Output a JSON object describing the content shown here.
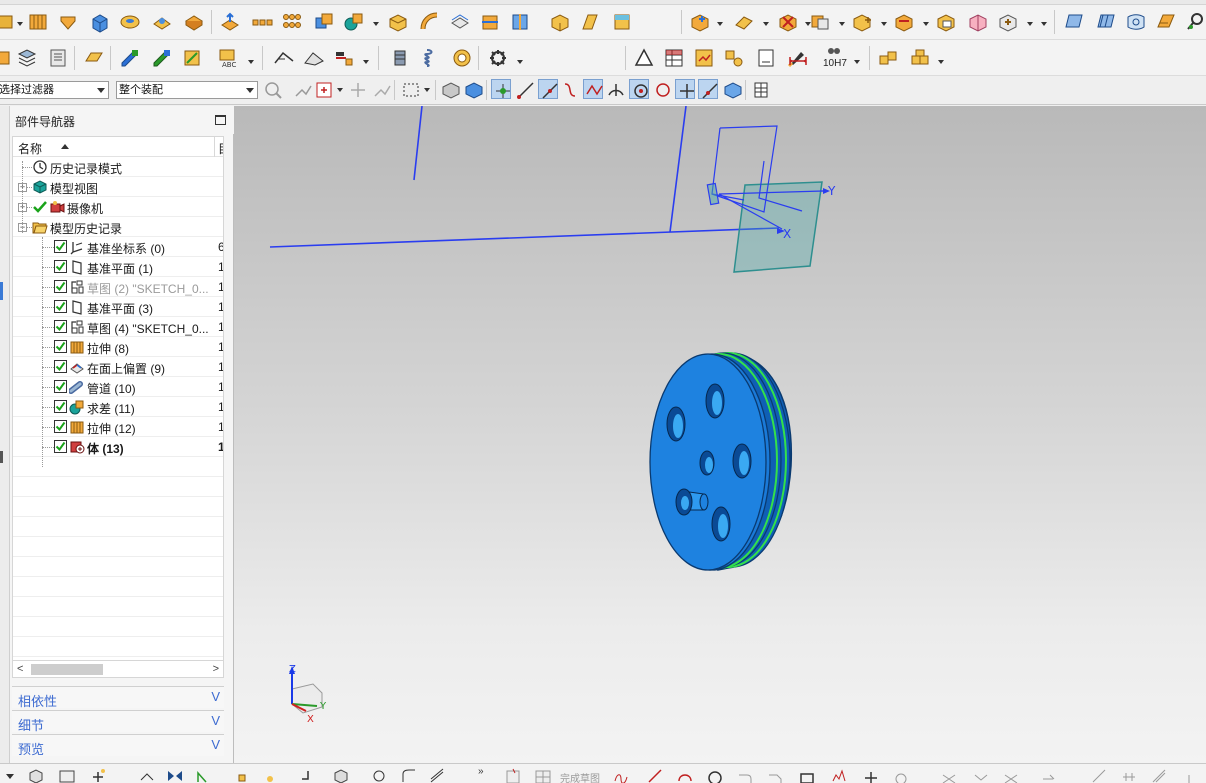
{
  "filters": {
    "selection_filter": "选择过滤器",
    "assembly_scope": "整个装配"
  },
  "toolbar_row3": {
    "drawing_label": "10H7"
  },
  "navigator": {
    "title": "部件导航器",
    "col_name": "名称",
    "col_extra": "目",
    "items": [
      {
        "label": "历史记录模式",
        "value": "",
        "icon": "history-clock-icon",
        "checked": null
      },
      {
        "label": "模型视图",
        "value": "",
        "icon": "model-view-icon",
        "checked": null
      },
      {
        "label": "摄像机",
        "value": "",
        "icon": "camera-icon",
        "checked": true
      },
      {
        "label": "模型历史记录",
        "value": "",
        "icon": "folder-open-icon",
        "checked": null
      },
      {
        "label": "基准坐标系 (0)",
        "value": "6",
        "icon": "datum-csys-icon",
        "checked": true
      },
      {
        "label": "基准平面 (1)",
        "value": "1",
        "icon": "datum-plane-icon",
        "checked": true
      },
      {
        "label": "草图 (2) \"SKETCH_0...",
        "value": "1",
        "icon": "sketch-icon",
        "checked": true
      },
      {
        "label": "基准平面 (3)",
        "value": "1",
        "icon": "datum-plane-icon",
        "checked": true
      },
      {
        "label": "草图 (4) \"SKETCH_0...",
        "value": "1",
        "icon": "sketch-icon",
        "checked": true
      },
      {
        "label": "拉伸 (8)",
        "value": "1",
        "icon": "extrude-icon",
        "checked": true
      },
      {
        "label": "在面上偏置 (9)",
        "value": "1",
        "icon": "offset-in-face-icon",
        "checked": true
      },
      {
        "label": "管道 (10)",
        "value": "1",
        "icon": "tube-icon",
        "checked": true
      },
      {
        "label": "求差 (11)",
        "value": "1",
        "icon": "subtract-icon",
        "checked": true
      },
      {
        "label": "拉伸 (12)",
        "value": "1",
        "icon": "extrude-icon",
        "checked": true
      },
      {
        "label": "体 (13)",
        "value": "1",
        "icon": "body-icon",
        "checked": true
      }
    ],
    "panels": {
      "dependencies": "相依性",
      "details": "细节",
      "preview": "预览"
    },
    "expand_glyph": "V"
  },
  "viewport": {
    "wcs_axes": {
      "x": "X",
      "y": "Y"
    },
    "triad": {
      "x": "X",
      "y": "Y",
      "z": "Z"
    }
  },
  "bottom_toolbar": {
    "finish_sketch": "完成草图"
  },
  "colors": {
    "part_blue": "#1e7ed6",
    "sketch_blue": "#2a3df0",
    "plane_teal": "#4aa8a8",
    "panel_link": "#3d6bd1",
    "check_green": "#1aa31a"
  }
}
